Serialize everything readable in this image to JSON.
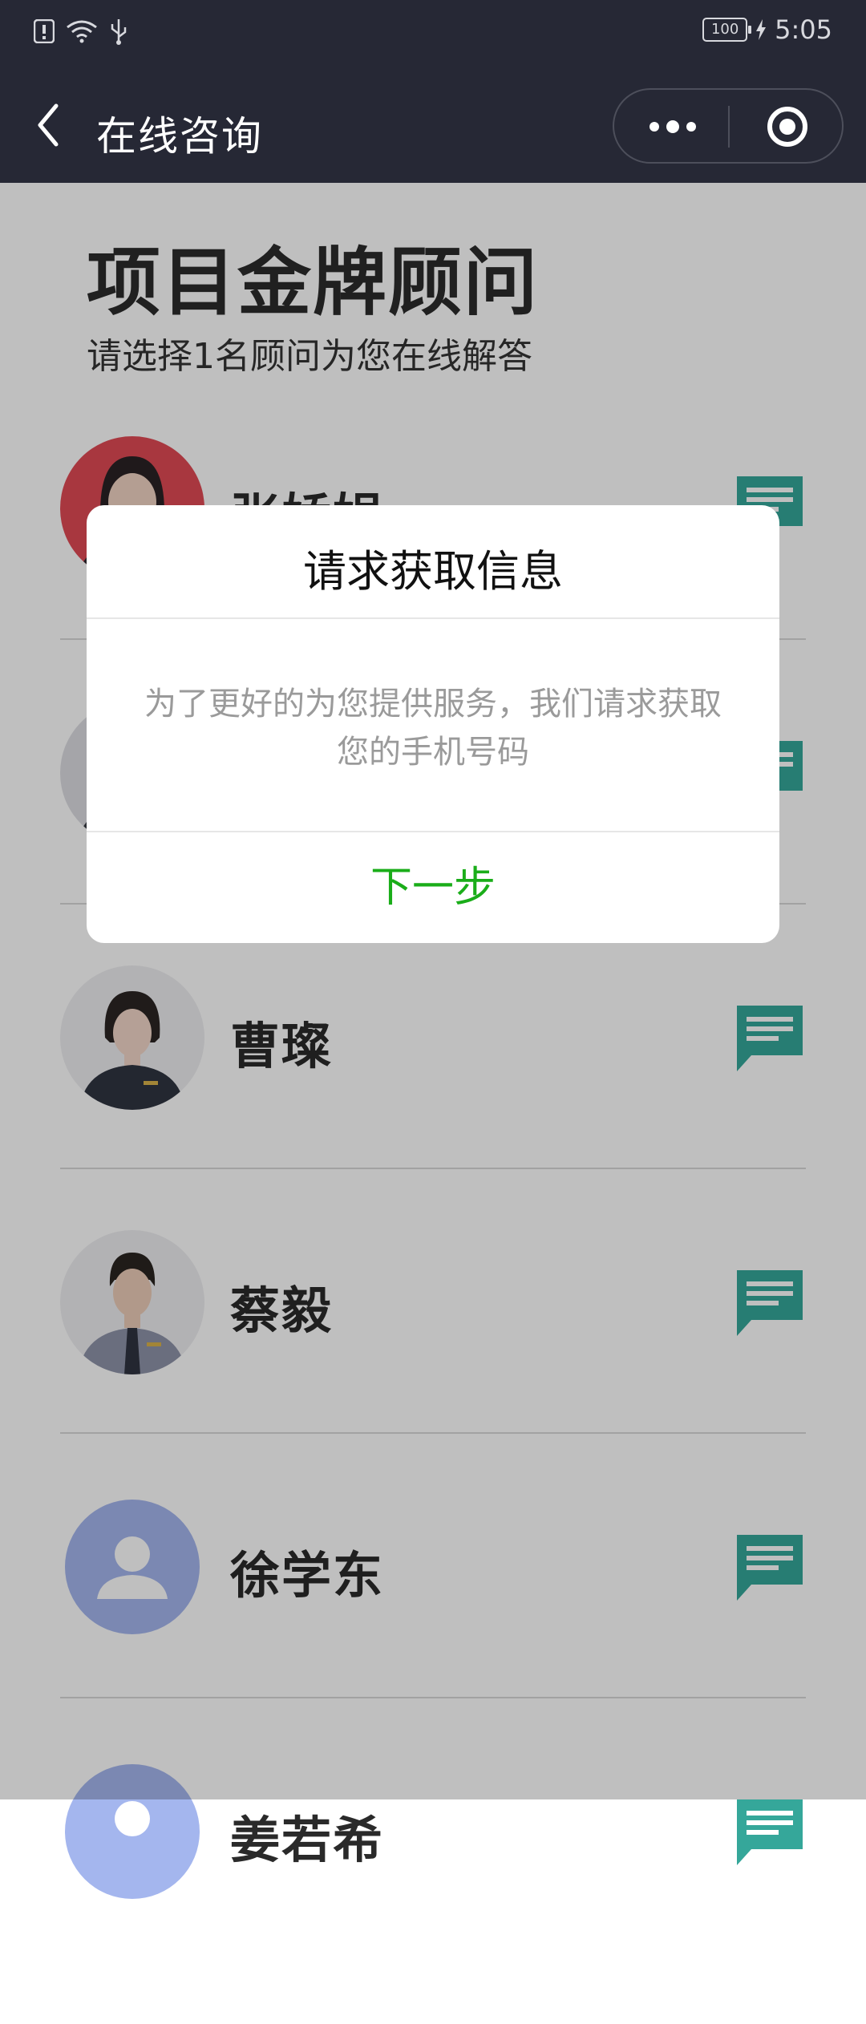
{
  "status": {
    "battery": "100",
    "time": "5:05"
  },
  "nav": {
    "title": "在线咨询"
  },
  "header": {
    "title": "项目金牌顾问",
    "subtitle": "请选择1名顾问为您在线解答"
  },
  "advisors": [
    {
      "name": "张娇娟"
    },
    {
      "name": ""
    },
    {
      "name": "曹璨"
    },
    {
      "name": "蔡毅"
    },
    {
      "name": "徐学东"
    },
    {
      "name": "姜若希"
    }
  ],
  "dialog": {
    "title": "请求获取信息",
    "message": "为了更好的为您提供服务，我们请求获取您的手机号码",
    "next_button": "下一步"
  },
  "colors": {
    "nav_bg": "#262835",
    "accent_green": "#1aad19",
    "chat_icon": "#35a79a"
  }
}
